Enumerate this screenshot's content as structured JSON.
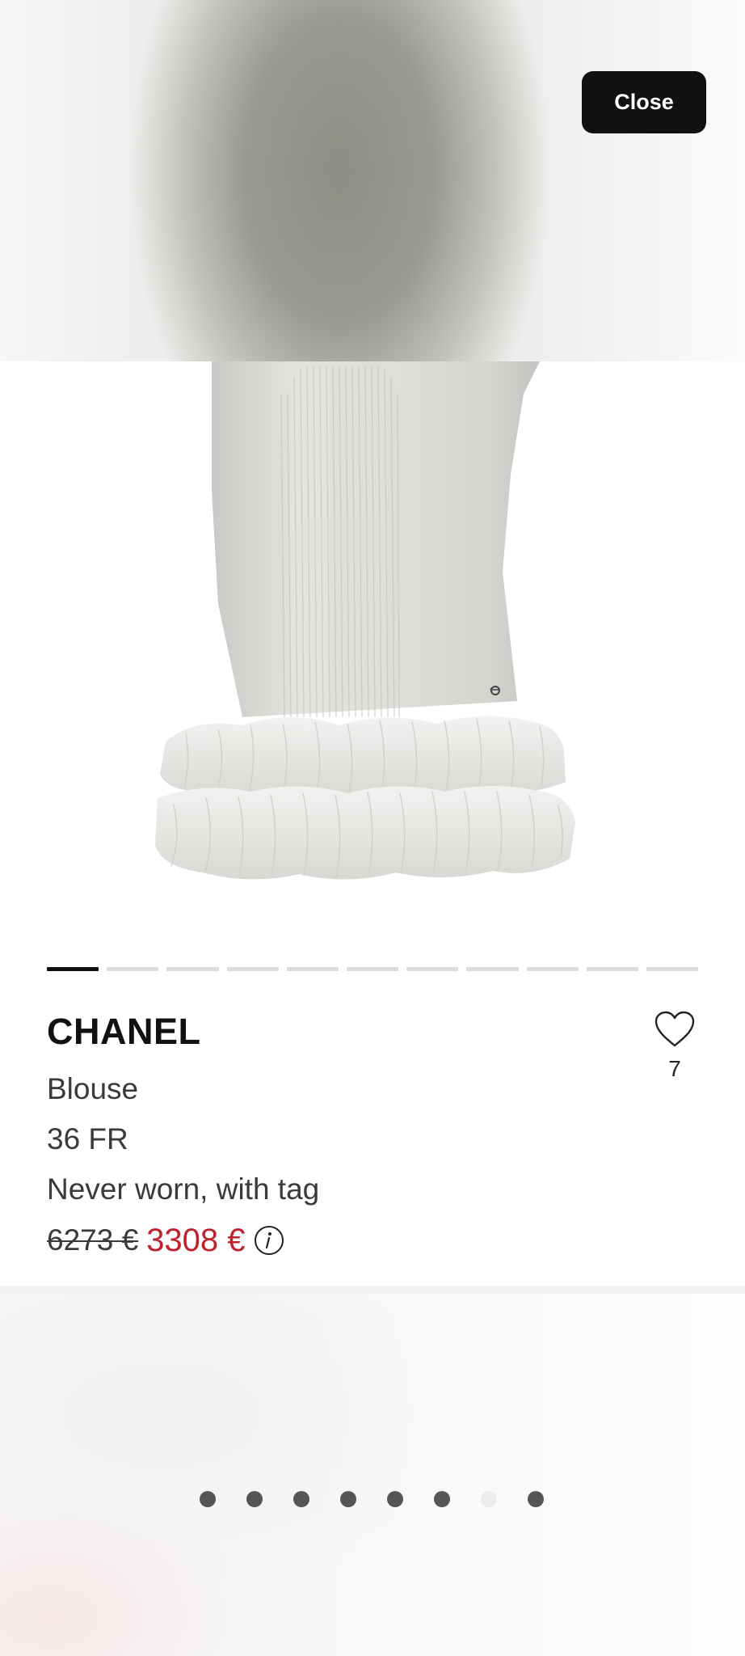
{
  "header": {
    "close_label": "Close"
  },
  "gallery": {
    "slide_count": 11,
    "active_index": 0
  },
  "product": {
    "brand": "CHANEL",
    "category": "Blouse",
    "size": "36 FR",
    "condition": "Never worn, with tag",
    "original_price": "6273 €",
    "sale_price": "3308 €",
    "likes": "7"
  },
  "recommendations": {
    "dot_count": 8,
    "active_index": 6
  },
  "colors": {
    "sale_price": "#c0222d",
    "close_button": "#111111"
  },
  "icons": {
    "favorite": "heart-outline-icon",
    "price_info": "info-circle-icon"
  }
}
